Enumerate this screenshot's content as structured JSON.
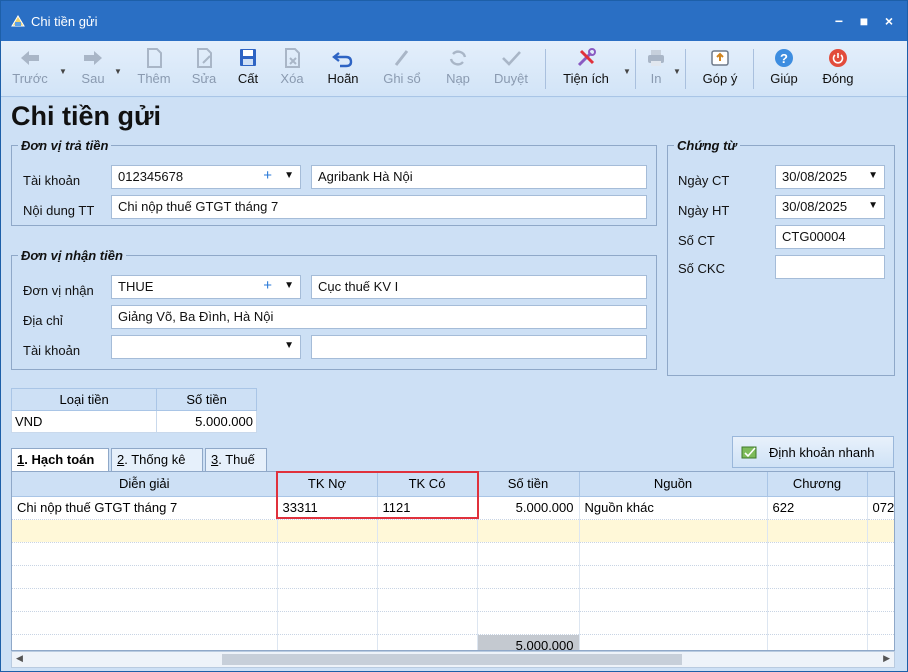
{
  "window": {
    "title": "Chi tiền gửi",
    "controls": [
      "−",
      "■",
      "×"
    ]
  },
  "toolbar": {
    "items": [
      {
        "label": "Trước",
        "enabled": false
      },
      {
        "label": "Sau",
        "enabled": false
      },
      {
        "label": "Thêm",
        "enabled": false
      },
      {
        "label": "Sửa",
        "enabled": false
      },
      {
        "label": "Cất",
        "enabled": true
      },
      {
        "label": "Xóa",
        "enabled": false
      },
      {
        "label": "Hoãn",
        "enabled": true
      },
      {
        "label": "Ghi sổ",
        "enabled": false
      },
      {
        "label": "Nạp",
        "enabled": false
      },
      {
        "label": "Duyệt",
        "enabled": false
      },
      {
        "label": "Tiện ích",
        "enabled": true
      },
      {
        "label": "In",
        "enabled": false
      },
      {
        "label": "Góp ý",
        "enabled": true
      },
      {
        "label": "Giúp",
        "enabled": true
      },
      {
        "label": "Đóng",
        "enabled": true
      }
    ]
  },
  "page_title": "Chi tiền gửi",
  "payer": {
    "legend": "Đơn vị trả tiền",
    "account_label": "Tài khoản",
    "account_value": "012345678",
    "bank_name": "Agribank Hà Nội",
    "content_label": "Nội dung TT",
    "content_value": "Chi nộp thuế GTGT tháng 7"
  },
  "receiver": {
    "legend": "Đơn vị nhận tiền",
    "unit_label": "Đơn vị nhận",
    "unit_value": "THUE",
    "unit_name": "Cục thuế KV I",
    "address_label": "Địa chỉ",
    "address_value": "Giảng Võ, Ba Đình, Hà Nội",
    "account_label": "Tài khoản",
    "account_value": "",
    "account_name": ""
  },
  "voucher": {
    "legend": "Chứng từ",
    "ngay_ct_label": "Ngày CT",
    "ngay_ct_value": "30/08/2025",
    "ngay_ht_label": "Ngày HT",
    "ngay_ht_value": "30/08/2025",
    "so_ct_label": "Số CT",
    "so_ct_value": "CTG00004",
    "so_ckc_label": "Số CKC",
    "so_ckc_value": ""
  },
  "currency": {
    "headers": [
      "Loại tiền",
      "Số tiền"
    ],
    "type": "VND",
    "amount": "5.000.000"
  },
  "tabs": [
    {
      "num": "1",
      "label": ". Hạch toán",
      "active": true
    },
    {
      "num": "2",
      "label": ". Thống kê",
      "active": false
    },
    {
      "num": "3",
      "label": ". Thuế",
      "active": false
    }
  ],
  "quick_button": "Định khoản nhanh",
  "grid": {
    "headers": [
      "Diễn giải",
      "TK Nợ",
      "TK Có",
      "Số tiền",
      "Nguồn",
      "Chương",
      ""
    ],
    "rows": [
      [
        "Chi nộp thuế GTGT tháng 7",
        "33311",
        "1121",
        "5.000.000",
        "Nguồn khác",
        "622",
        "072"
      ]
    ],
    "total": "5.000.000"
  },
  "colors": {
    "titlebar": "#2a6fc4",
    "highlight": "#e0313c",
    "background": "#cde0f5"
  }
}
